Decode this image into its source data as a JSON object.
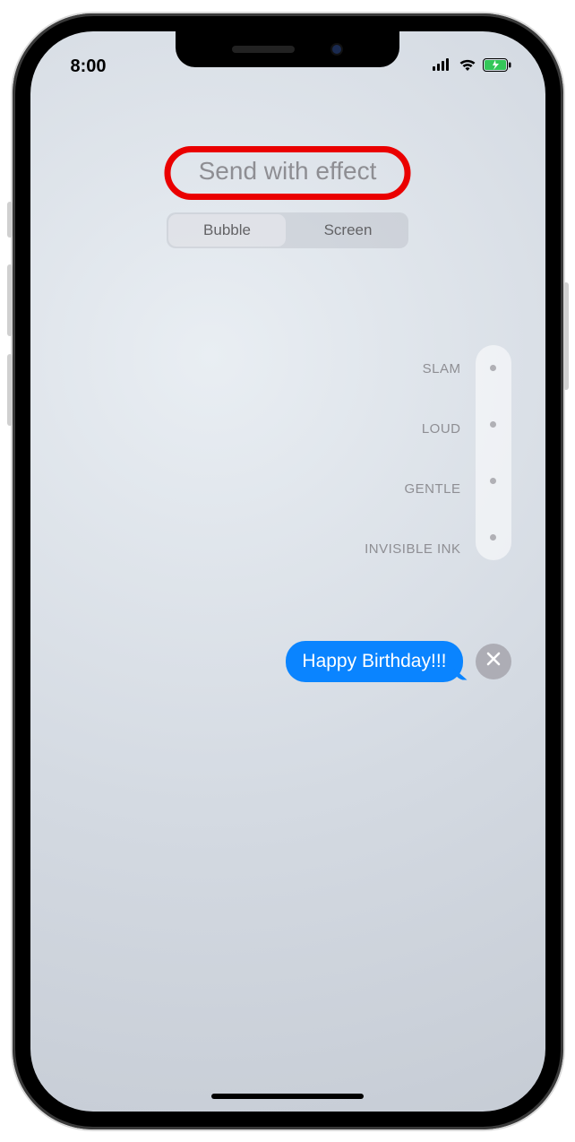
{
  "status": {
    "time": "8:00"
  },
  "header": {
    "title": "Send with effect",
    "tabs": [
      {
        "label": "Bubble",
        "active": true
      },
      {
        "label": "Screen",
        "active": false
      }
    ]
  },
  "effects": [
    {
      "label": "SLAM"
    },
    {
      "label": "LOUD"
    },
    {
      "label": "GENTLE"
    },
    {
      "label": "INVISIBLE INK"
    }
  ],
  "message": {
    "text": "Happy Birthday!!!"
  },
  "colors": {
    "accent": "#0a84ff",
    "highlight_ring": "#ea0000"
  }
}
